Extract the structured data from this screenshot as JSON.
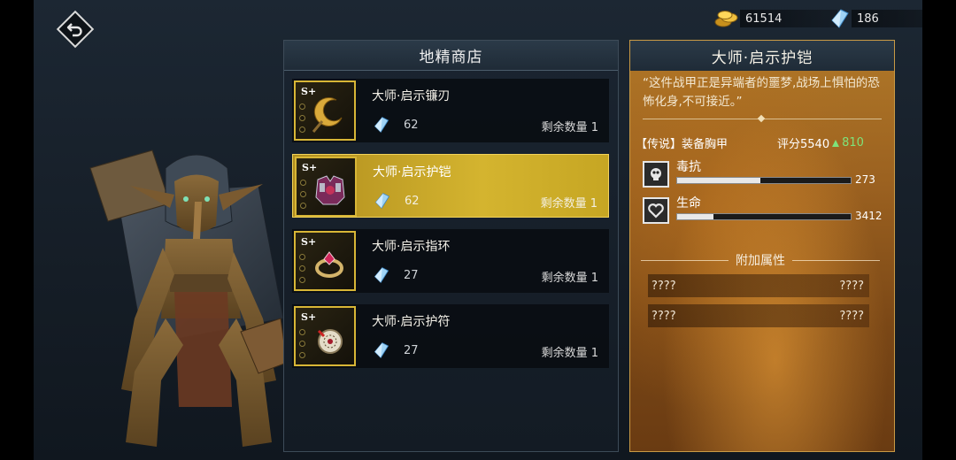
{
  "currency": {
    "gold": {
      "icon": "gold-coins-icon",
      "amount": "61514"
    },
    "crystal": {
      "icon": "blue-crystal-icon",
      "amount": "186"
    }
  },
  "shop": {
    "title": "地精商店",
    "items": [
      {
        "name": "大师·启示镰刃",
        "grade": "S+",
        "price": "62",
        "stock": "剩余数量 1",
        "icon": "scythe-icon",
        "selected": false
      },
      {
        "name": "大师·启示护铠",
        "grade": "S+",
        "price": "62",
        "stock": "剩余数量 1",
        "icon": "chest-armor-icon",
        "selected": true
      },
      {
        "name": "大师·启示指环",
        "grade": "S+",
        "price": "27",
        "stock": "剩余数量 1",
        "icon": "ring-icon",
        "selected": false
      },
      {
        "name": "大师·启示护符",
        "grade": "S+",
        "price": "27",
        "stock": "剩余数量 1",
        "icon": "amulet-icon",
        "selected": false
      }
    ]
  },
  "detail": {
    "title": "大师·启示护铠",
    "quote": "“这件战甲正是异端者的噩梦,战场上惧怕的恐怖化身,不可接近。”",
    "type": "【传说】装备胸甲",
    "score_label": "评分5540",
    "score_delta": "810",
    "stats": [
      {
        "name": "毒抗",
        "value": "273",
        "fill": 0.48,
        "icon": "poison-skull-icon"
      },
      {
        "name": "生命",
        "value": "3412",
        "fill": 0.21,
        "icon": "heart-icon"
      }
    ],
    "extra_title": "附加属性",
    "extras": [
      {
        "left": "????",
        "right": "????"
      },
      {
        "left": "????",
        "right": "????"
      }
    ]
  }
}
